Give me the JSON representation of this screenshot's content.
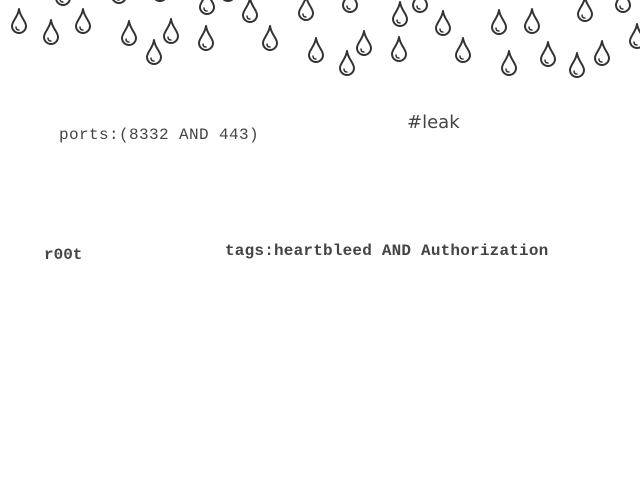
{
  "decoration": {
    "icon": "raindrop-icon",
    "stroke_color": "#333333",
    "fill_color": "#ffffff"
  },
  "texts": {
    "ports_query": "ports:(8332 AND 443)",
    "hashtag": "#leak",
    "username": "r00t",
    "tags_query": "tags:heartbleed AND Authorization"
  },
  "colors": {
    "text": "#444444",
    "background": "#ffffff"
  }
}
